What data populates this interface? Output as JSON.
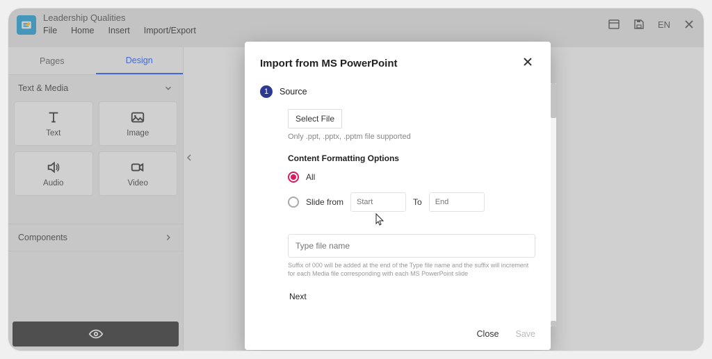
{
  "header": {
    "doc_title": "Leadership Qualities",
    "menu": {
      "file": "File",
      "home": "Home",
      "insert": "Insert",
      "import_export": "Import/Export"
    },
    "lang": "EN"
  },
  "sidebar": {
    "tabs": {
      "pages": "Pages",
      "design": "Design"
    },
    "section_text_media": "Text & Media",
    "cards": {
      "text": "Text",
      "image": "Image",
      "audio": "Audio",
      "video": "Video"
    },
    "components": "Components"
  },
  "modal": {
    "title": "Import from MS PowerPoint",
    "step1_num": "1",
    "step1_label": "Source",
    "select_file": "Select File",
    "file_hint": "Only .ppt, .pptx, .pptm file supported",
    "formatting_head": "Content Formatting Options",
    "opt_all": "All",
    "opt_slide_from": "Slide from",
    "start_placeholder": "Start",
    "to_label": "To",
    "end_placeholder": "End",
    "type_file_placeholder": "Type file name",
    "suffix_hint": "Suffix of 000 will be added at the end of the Type file name and the suffix will increment for each Media file corresponding with each MS PowerPoint slide",
    "next": "Next",
    "close": "Close",
    "save": "Save"
  }
}
